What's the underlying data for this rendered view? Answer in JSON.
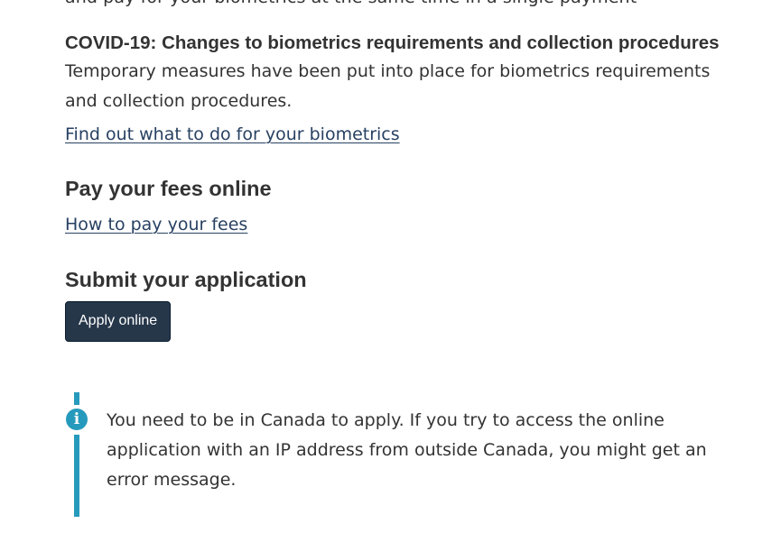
{
  "top_clipped_text": "and pay for your biometrics at the same time in a single payment",
  "covid": {
    "heading": "COVID-19: Changes to biometrics requirements and collection procedures",
    "body": "Temporary measures have been put into place for biometrics requirements and collection procedures.",
    "link": "Find out what to do for your biometrics"
  },
  "fees": {
    "heading": "Pay your fees online",
    "link": "How to pay your fees"
  },
  "submit": {
    "heading": "Submit your application",
    "button": "Apply online"
  },
  "alert": {
    "icon": "info-icon",
    "text": "You need to be in Canada to apply. If you try to access the online application with an IP address from outside Canada, you might get an error message.",
    "color": "#269abc"
  },
  "colors": {
    "text": "#333333",
    "link": "#284162",
    "button_bg": "#26374a"
  }
}
